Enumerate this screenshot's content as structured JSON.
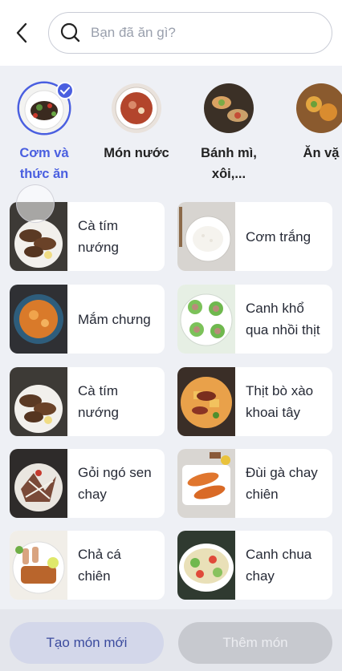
{
  "search": {
    "placeholder": "Bạn đã ăn gì?"
  },
  "categories": [
    {
      "label": "Cơm và thức ăn",
      "line1": "Cơm và",
      "line2": "thức ăn",
      "active": true
    },
    {
      "label": "Món nước",
      "line1": "Món nước",
      "line2": "",
      "active": false
    },
    {
      "label": "Bánh mì, xôi,...",
      "line1": "Bánh mì,",
      "line2": "xôi,...",
      "active": false
    },
    {
      "label": "Ăn vặt",
      "line1": "Ăn vặ",
      "line2": "",
      "active": false
    }
  ],
  "dishes": [
    {
      "line1": "Cà tím",
      "line2": "nướng"
    },
    {
      "line1": "Cơm trắng",
      "line2": ""
    },
    {
      "line1": "Mắm chưng",
      "line2": ""
    },
    {
      "line1": "Canh khổ",
      "line2": "qua nhồi thịt"
    },
    {
      "line1": "Cà tím",
      "line2": "nướng"
    },
    {
      "line1": "Thịt bò xào",
      "line2": "khoai tây"
    },
    {
      "line1": "Gỏi ngó sen",
      "line2": "chay"
    },
    {
      "line1": "Đùi gà chay",
      "line2": "chiên"
    },
    {
      "line1": "Chả cá",
      "line2": "chiên"
    },
    {
      "line1": "Canh chua",
      "line2": "chay"
    }
  ],
  "footer": {
    "create_label": "Tạo món mới",
    "add_label": "Thêm món"
  },
  "colors": {
    "accent": "#4a5fe0",
    "background": "#eef0f5"
  }
}
